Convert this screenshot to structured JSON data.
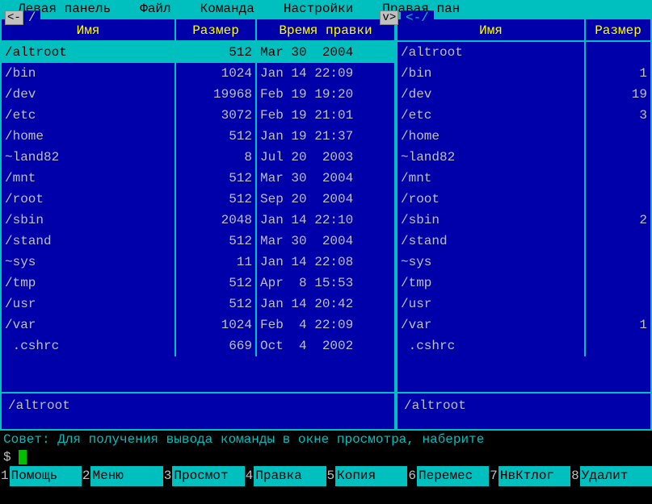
{
  "menu": {
    "left_panel": "Левая панель",
    "file": "Файл",
    "command": "Команда",
    "settings": "Настройки",
    "right_panel": "Правая пан"
  },
  "headers": {
    "name": "Имя",
    "size": "Размер",
    "mtime": "Время правки"
  },
  "left_panel": {
    "path": "/",
    "nav_back": "<-",
    "nav_dropdown": "v>",
    "selected": "/altroot",
    "files": [
      {
        "name": "/altroot",
        "size": "512",
        "mtime": "Mar 30  2004",
        "selected": true
      },
      {
        "name": "/bin",
        "size": "1024",
        "mtime": "Jan 14 22:09"
      },
      {
        "name": "/dev",
        "size": "19968",
        "mtime": "Feb 19 19:20"
      },
      {
        "name": "/etc",
        "size": "3072",
        "mtime": "Feb 19 21:01"
      },
      {
        "name": "/home",
        "size": "512",
        "mtime": "Jan 19 21:37"
      },
      {
        "name": "~land82",
        "size": "8",
        "mtime": "Jul 20  2003"
      },
      {
        "name": "/mnt",
        "size": "512",
        "mtime": "Mar 30  2004"
      },
      {
        "name": "/root",
        "size": "512",
        "mtime": "Sep 20  2004"
      },
      {
        "name": "/sbin",
        "size": "2048",
        "mtime": "Jan 14 22:10"
      },
      {
        "name": "/stand",
        "size": "512",
        "mtime": "Mar 30  2004"
      },
      {
        "name": "~sys",
        "size": "11",
        "mtime": "Jan 14 22:08"
      },
      {
        "name": "/tmp",
        "size": "512",
        "mtime": "Apr  8 15:53"
      },
      {
        "name": "/usr",
        "size": "512",
        "mtime": "Jan 14 20:42"
      },
      {
        "name": "/var",
        "size": "1024",
        "mtime": "Feb  4 22:09"
      },
      {
        "name": " .cshrc",
        "size": "669",
        "mtime": "Oct  4  2002"
      }
    ]
  },
  "right_panel": {
    "path": "<-/",
    "selected": "/altroot",
    "files": [
      {
        "name": "/altroot",
        "size": ""
      },
      {
        "name": "/bin",
        "size": "1"
      },
      {
        "name": "/dev",
        "size": "19"
      },
      {
        "name": "/etc",
        "size": "3"
      },
      {
        "name": "/home",
        "size": ""
      },
      {
        "name": "~land82",
        "size": ""
      },
      {
        "name": "/mnt",
        "size": ""
      },
      {
        "name": "/root",
        "size": ""
      },
      {
        "name": "/sbin",
        "size": "2"
      },
      {
        "name": "/stand",
        "size": ""
      },
      {
        "name": "~sys",
        "size": ""
      },
      {
        "name": "/tmp",
        "size": ""
      },
      {
        "name": "/usr",
        "size": ""
      },
      {
        "name": "/var",
        "size": "1"
      },
      {
        "name": " .cshrc",
        "size": ""
      }
    ]
  },
  "hint": "Совет: Для получения вывода команды в окне просмотра, наберите ",
  "prompt": "$",
  "fkeys": [
    {
      "n": "1",
      "label": "Помощь"
    },
    {
      "n": "2",
      "label": "Меню"
    },
    {
      "n": "3",
      "label": "Просмот"
    },
    {
      "n": "4",
      "label": "Правка"
    },
    {
      "n": "5",
      "label": "Копия"
    },
    {
      "n": "6",
      "label": "Перемес"
    },
    {
      "n": "7",
      "label": "НвКтлог"
    },
    {
      "n": "8",
      "label": "Удалит"
    }
  ]
}
